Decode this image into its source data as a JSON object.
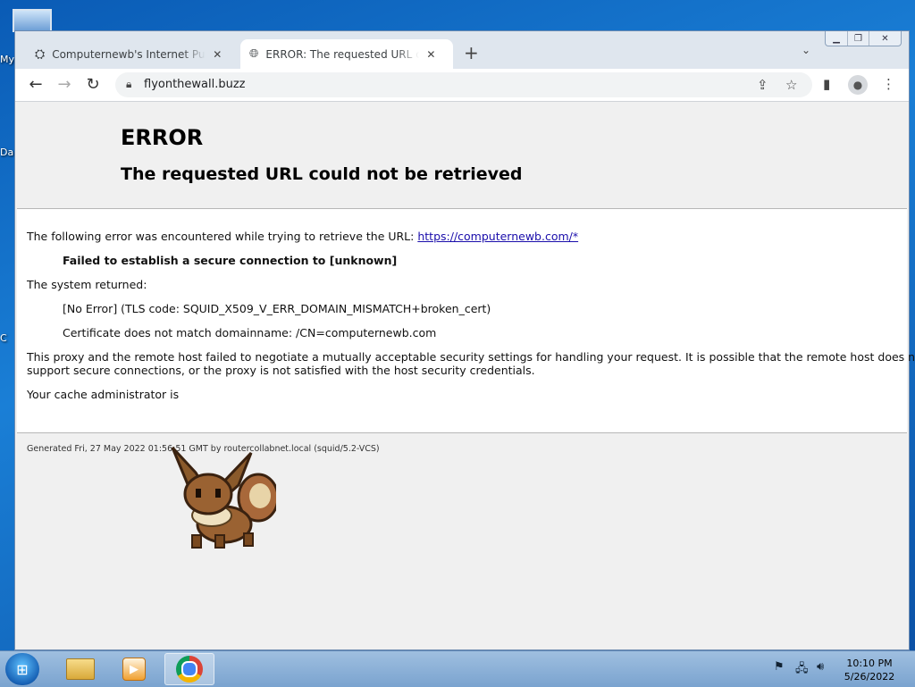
{
  "desktop": {
    "labels": [
      "My",
      "Da",
      "C"
    ]
  },
  "browser": {
    "tabs": [
      {
        "title": "Computernewb's Internet Pub Hub",
        "close": "✕"
      },
      {
        "title": "ERROR: The requested URL could not be retrieved",
        "close": "✕"
      }
    ],
    "new_tab": "+",
    "tab_menu": "⌄",
    "address": {
      "url": "flyonthewall.buzz"
    }
  },
  "page": {
    "heading": "ERROR",
    "subheading": "The requested URL could not be retrieved",
    "intro_text": "The following error was encountered while trying to retrieve the URL: ",
    "intro_link": "https://computernewb.com/*",
    "failed": "Failed to establish a secure connection to [unknown]",
    "system_returned": "The system returned:",
    "tls_code": "[No Error] (TLS code: SQUID_X509_V_ERR_DOMAIN_MISMATCH+broken_cert)",
    "cert_msg": "Certificate does not match domainname: /CN=computernewb.com",
    "proxy_line1": "This proxy and the remote host failed to negotiate a mutually acceptable security settings for handling your request. It is possible that the remote host does not",
    "proxy_line2": "support secure connections, or the proxy is not satisfied with the host security credentials.",
    "cache_admin": "Your cache administrator is",
    "footer": "Generated Fri, 27 May 2022 01:56:51 GMT by routercollabnet.local (squid/5.2-VCS)"
  },
  "taskbar": {
    "clock_time": "10:10 PM",
    "clock_date": "5/26/2022"
  },
  "colors": {
    "link": "#1a0dab",
    "panel_bg": "#ffffff",
    "page_bg": "#f0f0f0"
  }
}
